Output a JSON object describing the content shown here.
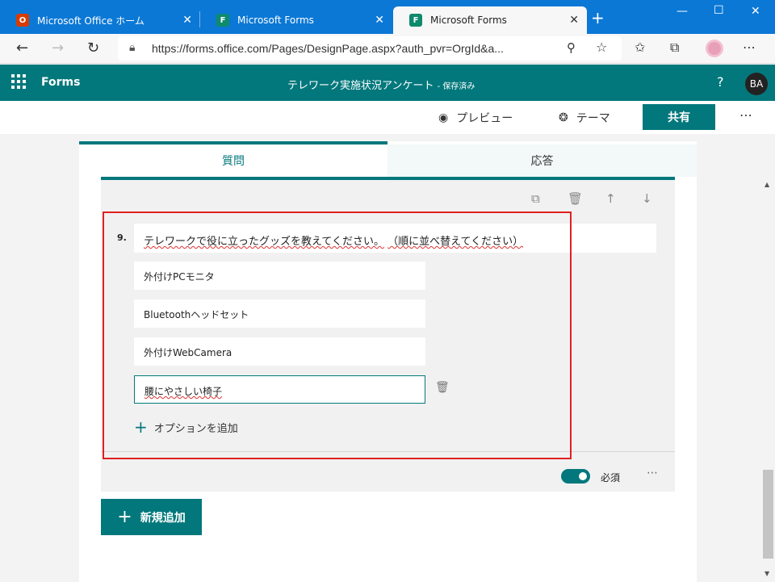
{
  "browser": {
    "tabs": [
      {
        "label": "Microsoft Office ホーム",
        "icon": "office-icon"
      },
      {
        "label": "Microsoft Forms",
        "icon": "forms-icon"
      },
      {
        "label": "Microsoft Forms",
        "icon": "forms-icon",
        "active": true
      }
    ],
    "url": "https://forms.office.com/Pages/DesignPage.aspx?auth_pvr=OrgId&a..."
  },
  "forms_header": {
    "app_name": "Forms",
    "form_title": "テレワーク実施状況アンケート",
    "saved_status": "- 保存済み",
    "help": "?",
    "avatar_initials": "BA"
  },
  "command_bar": {
    "preview_label": "プレビュー",
    "theme_label": "テーマ",
    "share_label": "共有"
  },
  "designer_tabs": {
    "questions_label": "質問",
    "responses_label": "応答"
  },
  "question": {
    "number": "9.",
    "title": "テレワークで役に立ったグッズを教えてください。",
    "subtitle": "（順に並べ替えてください）",
    "options": [
      "外付けPCモニタ",
      "Bluetoothヘッドセット",
      "外付けWebCamera",
      "腰にやさしい椅子"
    ],
    "add_option_label": "オプションを追加",
    "required_label": "必須",
    "required_on": true
  },
  "add_new_label": "新規追加",
  "colors": {
    "accent": "#03787c",
    "browser_blue": "#0b78d6",
    "highlight_red": "#e02020"
  }
}
